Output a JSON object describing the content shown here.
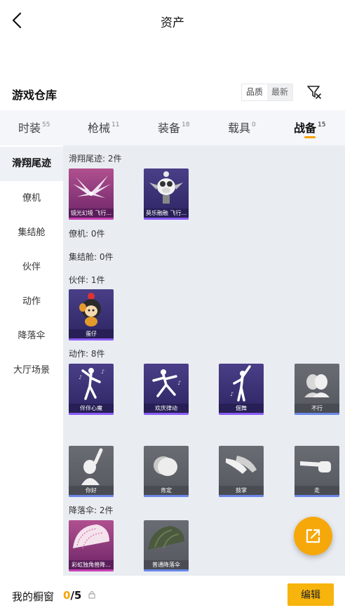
{
  "header": {
    "title": "资产"
  },
  "section": {
    "title": "游戏仓库",
    "sort_options": [
      "品质",
      "最新"
    ]
  },
  "tabs": [
    {
      "label": "时装",
      "count": "55"
    },
    {
      "label": "枪械",
      "count": "11"
    },
    {
      "label": "装备",
      "count": "18"
    },
    {
      "label": "载具",
      "count": "0"
    },
    {
      "label": "战备",
      "count": "15"
    }
  ],
  "sidebar": [
    {
      "label": "滑翔尾迹"
    },
    {
      "label": "僚机"
    },
    {
      "label": "集结舱"
    },
    {
      "label": "伙伴"
    },
    {
      "label": "动作"
    },
    {
      "label": "降落伞"
    },
    {
      "label": "大厅场景"
    }
  ],
  "groups": {
    "glide": {
      "header": "滑翔尾迹: 2件",
      "items": [
        "镜光幻境 飞行...",
        "莫乐融融 飞行..."
      ]
    },
    "drone": {
      "header": "僚机: 0件"
    },
    "pod": {
      "header": "集结舱: 0件"
    },
    "partner": {
      "header": "伙伴: 1件",
      "items": [
        "蛋仔"
      ]
    },
    "emote": {
      "header": "动作: 8件",
      "items": [
        "伴伴心魔",
        "欢庆律动",
        "倔舞",
        "不行",
        "你好",
        "肯定",
        "鼓掌",
        "走"
      ]
    },
    "parachute": {
      "header": "降落伞: 2件",
      "items": [
        "彩虹独角兽降...",
        "普通降落伞"
      ]
    }
  },
  "bottom": {
    "label": "我的橱窗",
    "used": "0",
    "total": "/5",
    "edit_label": "编辑"
  },
  "colors": {
    "accent": "#f5a300",
    "button": "#f7b40c"
  }
}
